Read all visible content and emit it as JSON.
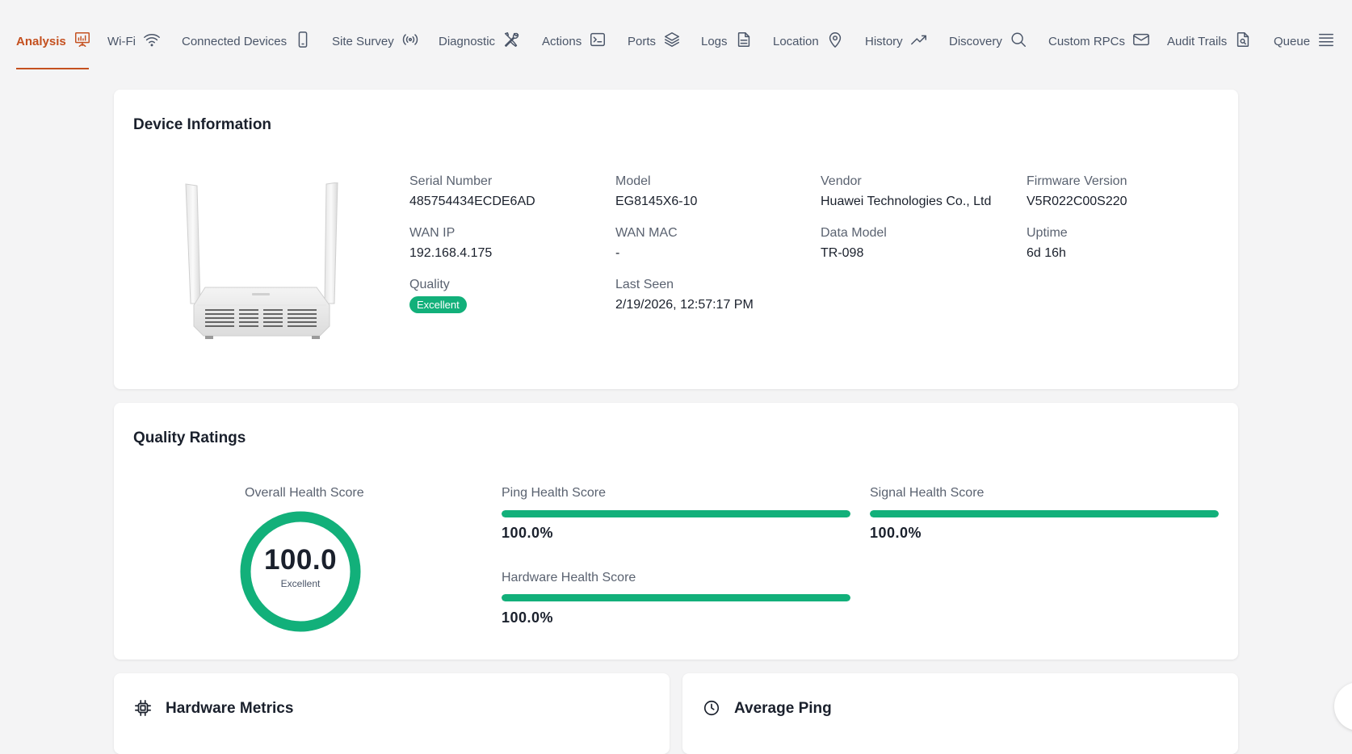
{
  "nav": {
    "tabs": [
      {
        "label": "Analysis",
        "icon": "presentation-chart-icon",
        "active": true
      },
      {
        "label": "Wi-Fi",
        "icon": "wifi-icon"
      },
      {
        "label": "Connected Devices",
        "icon": "smartphone-icon"
      },
      {
        "label": "Site Survey",
        "icon": "radio-signal-icon"
      },
      {
        "label": "Diagnostic",
        "icon": "tools-icon"
      },
      {
        "label": "Actions",
        "icon": "terminal-icon"
      },
      {
        "label": "Ports",
        "icon": "layers-icon"
      },
      {
        "label": "Logs",
        "icon": "file-icon"
      },
      {
        "label": "Location",
        "icon": "map-pin-icon"
      },
      {
        "label": "History",
        "icon": "trending-up-icon"
      },
      {
        "label": "Discovery",
        "icon": "search-icon"
      },
      {
        "label": "Custom RPCs",
        "icon": "mail-icon"
      },
      {
        "label": "Audit Trails",
        "icon": "file-search-icon"
      },
      {
        "label": "Queue",
        "icon": "list-icon"
      }
    ],
    "active_color": "#c4501f"
  },
  "device_info": {
    "title": "Device Information",
    "serial": {
      "label": "Serial Number",
      "value": "485754434ECDE6AD"
    },
    "model": {
      "label": "Model",
      "value": "EG8145X6-10"
    },
    "vendor": {
      "label": "Vendor",
      "value": "Huawei Technologies Co., Ltd"
    },
    "firmware": {
      "label": "Firmware Version",
      "value": "V5R022C00S220"
    },
    "wan_ip": {
      "label": "WAN IP",
      "value": "192.168.4.175"
    },
    "wan_mac": {
      "label": "WAN MAC",
      "value": "-"
    },
    "data_model": {
      "label": "Data Model",
      "value": "TR-098"
    },
    "uptime": {
      "label": "Uptime",
      "value": "6d 16h"
    },
    "quality": {
      "label": "Quality",
      "value": "Excellent"
    },
    "last_seen": {
      "label": "Last Seen",
      "value": "2/19/2026, 12:57:17 PM"
    }
  },
  "quality_ratings": {
    "title": "Quality Ratings",
    "overall": {
      "label": "Overall Health Score",
      "value": "100.0",
      "rating": "Excellent",
      "fraction": 1.0
    },
    "ping": {
      "label": "Ping Health Score",
      "value": "100.0%",
      "fraction": 1.0
    },
    "signal": {
      "label": "Signal Health Score",
      "value": "100.0%",
      "fraction": 1.0
    },
    "hardware": {
      "label": "Hardware Health Score",
      "value": "100.0%",
      "fraction": 1.0
    },
    "good_color": "#12b07a"
  },
  "hardware_metrics": {
    "title": "Hardware Metrics",
    "icon": "cpu-chip-icon"
  },
  "average_ping": {
    "title": "Average Ping",
    "icon": "clock-icon"
  }
}
